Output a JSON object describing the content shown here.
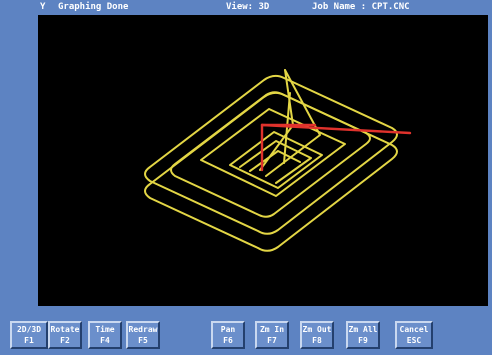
{
  "status_bar": {
    "axis": "Y",
    "status": "Graphing Done",
    "view": "View: 3D",
    "job": "Job Name : CPT.CNC"
  },
  "colors": {
    "background": "#5d83c2",
    "viewport": "#000000",
    "toolpath": "#e3d645",
    "axis_marker": "#e0322c"
  },
  "function_keys": [
    {
      "label": "2D/3D",
      "key": "F1"
    },
    {
      "label": "Rotate",
      "key": "F2"
    },
    {
      "label": "Time",
      "key": "F4"
    },
    {
      "label": "Redraw",
      "key": "F5"
    },
    {
      "label": "Pan",
      "key": "F6"
    },
    {
      "label": "Zm In",
      "key": "F7"
    },
    {
      "label": "Zm Out",
      "key": "F8"
    },
    {
      "label": "Zm All",
      "key": "F9"
    },
    {
      "label": "Cancel",
      "key": "ESC"
    }
  ]
}
